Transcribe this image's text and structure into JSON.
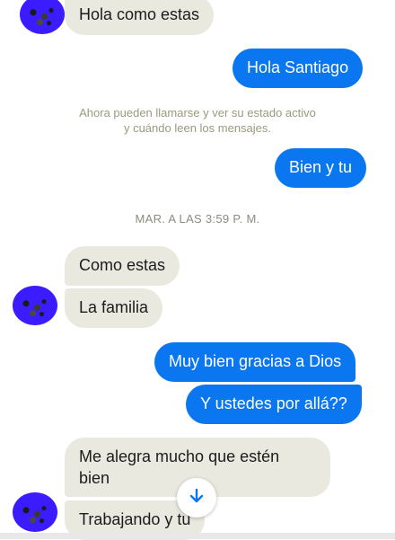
{
  "messages": [
    {
      "text": "Hola como estas",
      "dir": "in"
    },
    {
      "text": "Hola Santiago",
      "dir": "out"
    },
    {
      "text": "Bien y tu",
      "dir": "out"
    },
    {
      "text": "Como estas",
      "dir": "in"
    },
    {
      "text": "La familia",
      "dir": "in"
    },
    {
      "text": "Muy bien gracias a Dios",
      "dir": "out"
    },
    {
      "text": "Y ustedes por allá??",
      "dir": "out"
    },
    {
      "text": "Me alegra mucho que estén",
      "dir": "in"
    },
    {
      "text": "bien",
      "dir": "in"
    },
    {
      "text": "Trabajando y tu",
      "dir": "in"
    }
  ],
  "system_notice": {
    "line1": "Ahora pueden llamarse y ver su estado activo",
    "line2": "y cuándo leen los mensajes."
  },
  "timestamp": "MAR. A LAS 3:59 P. M.",
  "colors": {
    "incoming_bubble": "#e9e9df",
    "outgoing_bubble": "#0a76f0",
    "avatar": "#3a1cff"
  },
  "icons": {
    "scroll_down": "arrow-down-icon"
  }
}
